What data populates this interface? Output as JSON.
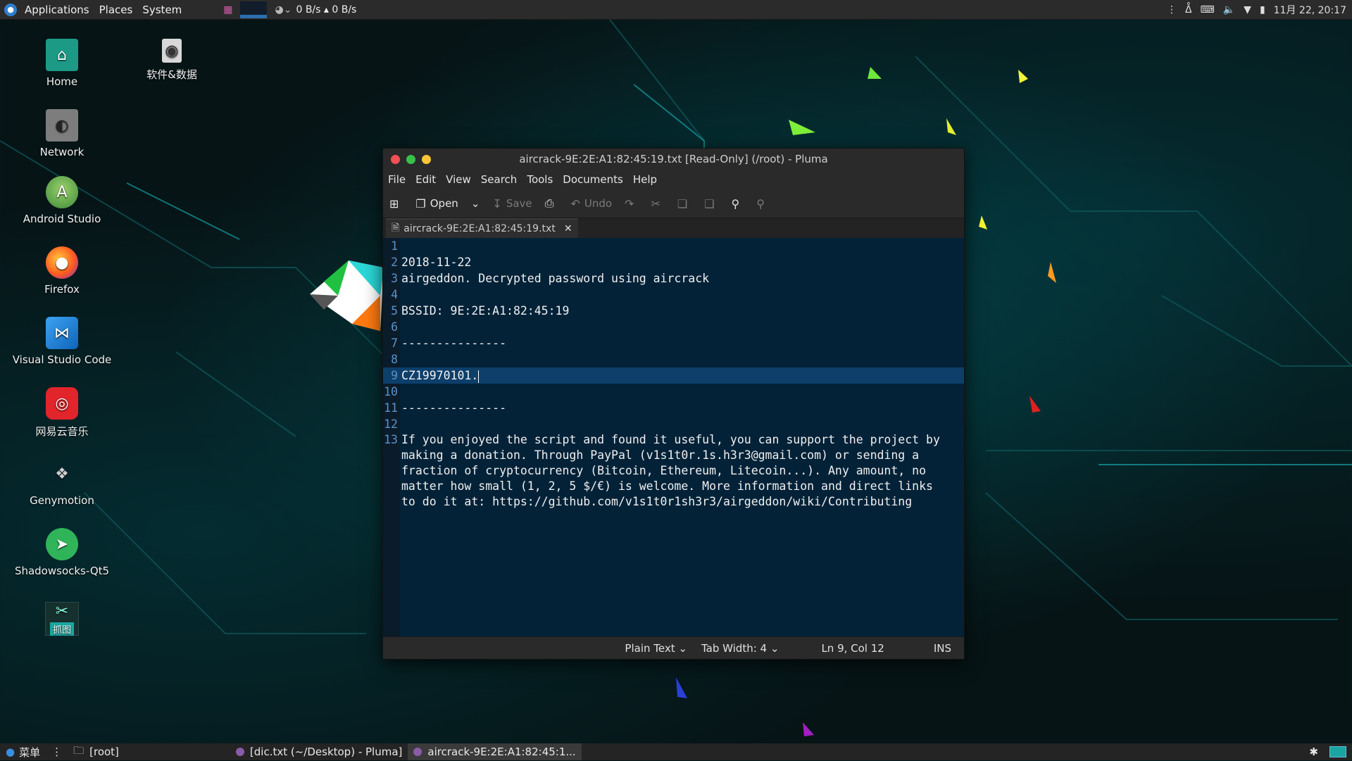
{
  "top_panel": {
    "menus": [
      "Applications",
      "Places",
      "System"
    ],
    "network": "0 B/s ▴ 0 B/s",
    "datetime": "11月 22, 20:17"
  },
  "desktop_icons": [
    {
      "label": "Home"
    },
    {
      "label": "Network"
    },
    {
      "label": "Android Studio"
    },
    {
      "label": "Firefox"
    },
    {
      "label": "Visual Studio Code"
    },
    {
      "label": "网易云音乐"
    },
    {
      "label": "Genymotion"
    },
    {
      "label": "Shadowsocks-Qt5"
    },
    {
      "label": "抓图"
    },
    {
      "label": "软件&数据"
    }
  ],
  "window": {
    "title": "aircrack-9E:2E:A1:82:45:19.txt [Read-Only] (/root) - Pluma",
    "menu": [
      "File",
      "Edit",
      "View",
      "Search",
      "Tools",
      "Documents",
      "Help"
    ],
    "toolbar": {
      "open": "Open",
      "save": "Save",
      "undo": "Undo"
    },
    "tab": "aircrack-9E:2E:A1:82:45:19.txt",
    "lines": [
      {
        "n": "1",
        "t": ""
      },
      {
        "n": "2",
        "t": "2018-11-22"
      },
      {
        "n": "3",
        "t": "airgeddon. Decrypted password using aircrack"
      },
      {
        "n": "4",
        "t": ""
      },
      {
        "n": "5",
        "t": "BSSID: 9E:2E:A1:82:45:19"
      },
      {
        "n": "6",
        "t": ""
      },
      {
        "n": "7",
        "t": "---------------"
      },
      {
        "n": "8",
        "t": ""
      },
      {
        "n": "9",
        "t": "CZ19970101."
      },
      {
        "n": "10",
        "t": ""
      },
      {
        "n": "11",
        "t": "---------------"
      },
      {
        "n": "12",
        "t": ""
      },
      {
        "n": "13",
        "t": "If you enjoyed the script and found it useful, you can support the project by"
      },
      {
        "n": "",
        "t": "making a donation. Through PayPal (v1s1t0r.1s.h3r3@gmail.com) or sending a"
      },
      {
        "n": "",
        "t": "fraction of cryptocurrency (Bitcoin, Ethereum, Litecoin...). Any amount, no"
      },
      {
        "n": "",
        "t": "matter how small (1, 2, 5 $/€) is welcome. More information and direct links"
      },
      {
        "n": "",
        "t": "to do it at: https://github.com/v1s1t0r1sh3r3/airgeddon/wiki/Contributing"
      }
    ],
    "status": {
      "syntax": "Plain Text",
      "tab_width": "Tab Width: 4",
      "position": "Ln 9, Col 12",
      "mode": "INS"
    }
  },
  "bottom_panel": {
    "menu": "菜单",
    "folder": "[root]",
    "tasks": [
      "[dic.txt (~/Desktop) - Pluma]",
      "aircrack-9E:2E:A1:82:45:1..."
    ]
  }
}
